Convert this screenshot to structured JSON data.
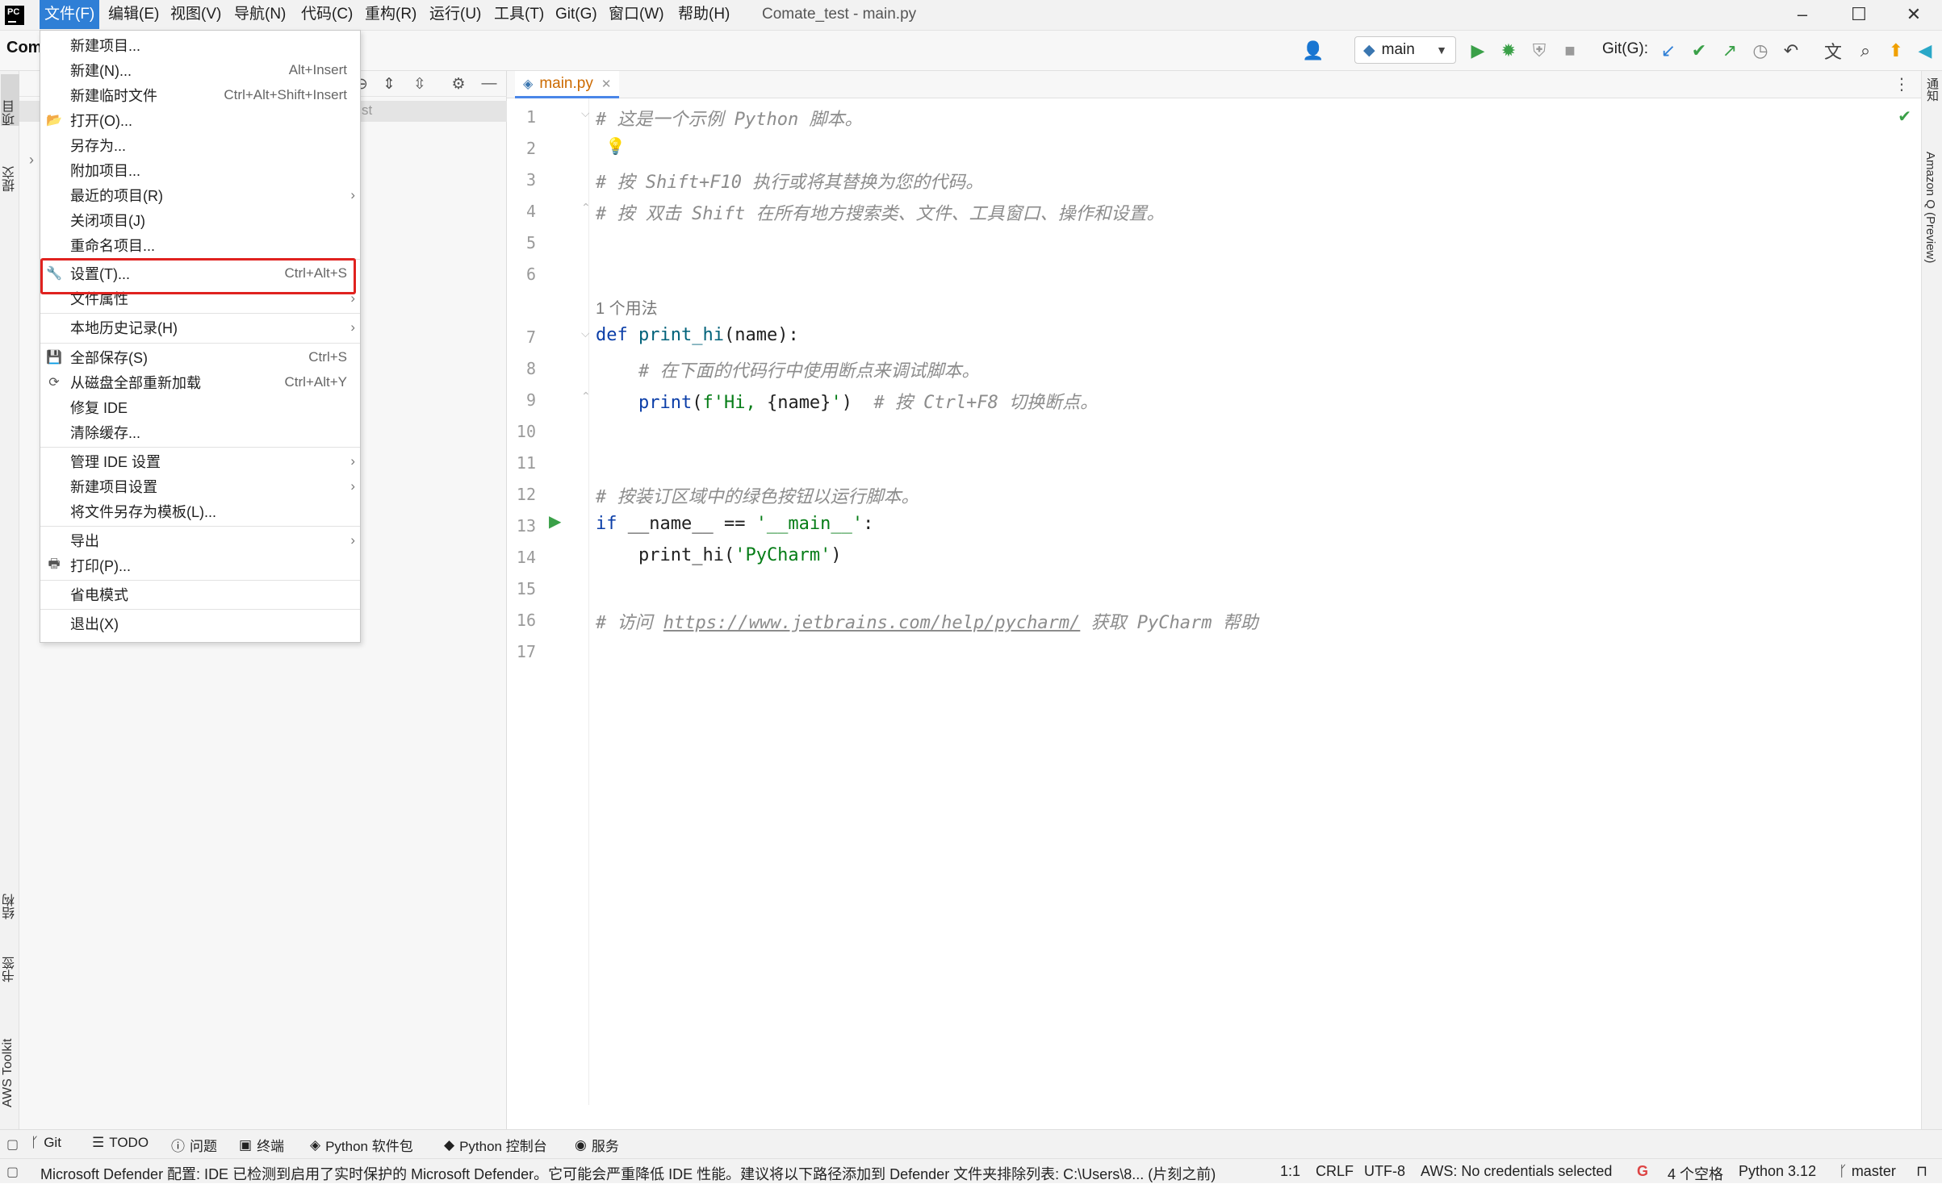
{
  "app": {
    "window_title": "Comate_test - main.py",
    "project_short": "Com"
  },
  "menubar": {
    "items": [
      "文件(F)",
      "编辑(E)",
      "视图(V)",
      "导航(N)",
      "代码(C)",
      "重构(R)",
      "运行(U)",
      "工具(T)",
      "Git(G)",
      "窗口(W)",
      "帮助(H)"
    ],
    "active_index": 0
  },
  "toolbar": {
    "branch": "main",
    "git_label": "Git(G):"
  },
  "file_menu": {
    "items": [
      {
        "label": "新建项目...",
        "shortcut": "",
        "arrow": false,
        "icon": ""
      },
      {
        "label": "新建(N)...",
        "shortcut": "Alt+Insert",
        "arrow": false,
        "icon": ""
      },
      {
        "label": "新建临时文件",
        "shortcut": "Ctrl+Alt+Shift+Insert",
        "arrow": false,
        "icon": ""
      },
      {
        "label": "打开(O)...",
        "shortcut": "",
        "arrow": false,
        "icon": "folder-open-icon"
      },
      {
        "label": "另存为...",
        "shortcut": "",
        "arrow": false,
        "icon": ""
      },
      {
        "label": "附加项目...",
        "shortcut": "",
        "arrow": false,
        "icon": ""
      },
      {
        "label": "最近的项目(R)",
        "shortcut": "",
        "arrow": true,
        "icon": ""
      },
      {
        "label": "关闭项目(J)",
        "shortcut": "",
        "arrow": false,
        "icon": ""
      },
      {
        "label": "重命名项目...",
        "shortcut": "",
        "arrow": false,
        "icon": ""
      },
      {
        "label": "设置(T)...",
        "shortcut": "Ctrl+Alt+S",
        "arrow": false,
        "icon": "wrench-icon"
      },
      {
        "label": "文件属性",
        "shortcut": "",
        "arrow": true,
        "icon": ""
      },
      {
        "label": "本地历史记录(H)",
        "shortcut": "",
        "arrow": true,
        "icon": ""
      },
      {
        "label": "全部保存(S)",
        "shortcut": "Ctrl+S",
        "arrow": false,
        "icon": "save-icon"
      },
      {
        "label": "从磁盘全部重新加载",
        "shortcut": "Ctrl+Alt+Y",
        "arrow": false,
        "icon": "reload-icon"
      },
      {
        "label": "修复 IDE",
        "shortcut": "",
        "arrow": false,
        "icon": ""
      },
      {
        "label": "清除缓存...",
        "shortcut": "",
        "arrow": false,
        "icon": ""
      },
      {
        "label": "管理 IDE 设置",
        "shortcut": "",
        "arrow": true,
        "icon": ""
      },
      {
        "label": "新建项目设置",
        "shortcut": "",
        "arrow": true,
        "icon": ""
      },
      {
        "label": "将文件另存为模板(L)...",
        "shortcut": "",
        "arrow": false,
        "icon": ""
      },
      {
        "label": "导出",
        "shortcut": "",
        "arrow": true,
        "icon": ""
      },
      {
        "label": "打印(P)...",
        "shortcut": "",
        "arrow": false,
        "icon": "print-icon"
      },
      {
        "label": "省电模式",
        "shortcut": "",
        "arrow": false,
        "icon": ""
      },
      {
        "label": "退出(X)",
        "shortcut": "",
        "arrow": false,
        "icon": ""
      }
    ]
  },
  "project_panel": {
    "row_fragment": "st"
  },
  "editor": {
    "tab_label": "main.py",
    "usage_hint": "1 个用法",
    "line_numbers": [
      "1",
      "2",
      "3",
      "4",
      "5",
      "6",
      "7",
      "8",
      "9",
      "10",
      "11",
      "12",
      "13",
      "14",
      "15",
      "16",
      "17"
    ],
    "code": {
      "l1": "# 这是一个示例 Python 脚本。",
      "l3": "# 按 Shift+F10 执行或将其替换为您的代码。",
      "l4": "# 按 双击 Shift 在所有地方搜索类、文件、工具窗口、操作和设置。",
      "l7_kw": "def",
      "l7_fn": "print_hi",
      "l7_rest": "(name):",
      "l8": "# 在下面的代码行中使用断点来调试脚本。",
      "l9_fn": "print",
      "l9_a": "(",
      "l9_str1": "f'Hi, ",
      "l9_var": "{name}",
      "l9_str2": "'",
      "l9_b": ")",
      "l9_cm": "# 按 Ctrl+F8 切换断点。",
      "l12": "# 按装订区域中的绿色按钮以运行脚本。",
      "l13_kw": "if",
      "l13_a": " __name__ == ",
      "l13_str": "'__main__'",
      "l13_b": ":",
      "l14_fn": "print_hi",
      "l14_a": "(",
      "l14_str": "'PyCharm'",
      "l14_b": ")",
      "l16_a": "# 访问 ",
      "l16_link": "https://www.jetbrains.com/help/pycharm/",
      "l16_b": " 获取 PyCharm 帮助"
    }
  },
  "left_tabs": {
    "project": "项目",
    "commit": "提交",
    "structure": "结构",
    "bookmarks": "书签",
    "aws": "AWS Toolkit"
  },
  "right_tabs": {
    "notifications": "通知",
    "amazon_q": "Amazon Q (Preview)"
  },
  "tool_tabs": [
    "Git",
    "TODO",
    "问题",
    "终端",
    "Python 软件包",
    "Python 控制台",
    "服务"
  ],
  "status": {
    "message": "Microsoft Defender 配置: IDE 已检测到启用了实时保护的 Microsoft Defender。它可能会严重降低 IDE 性能。建议将以下路径添加到 Defender 文件夹排除列表: C:\\Users\\8... (片刻之前)",
    "position": "1:1",
    "line_sep": "CRLF",
    "encoding": "UTF-8",
    "aws": "AWS: No credentials selected",
    "indent": "4 个空格",
    "interpreter": "Python 3.12",
    "branch": "master"
  }
}
